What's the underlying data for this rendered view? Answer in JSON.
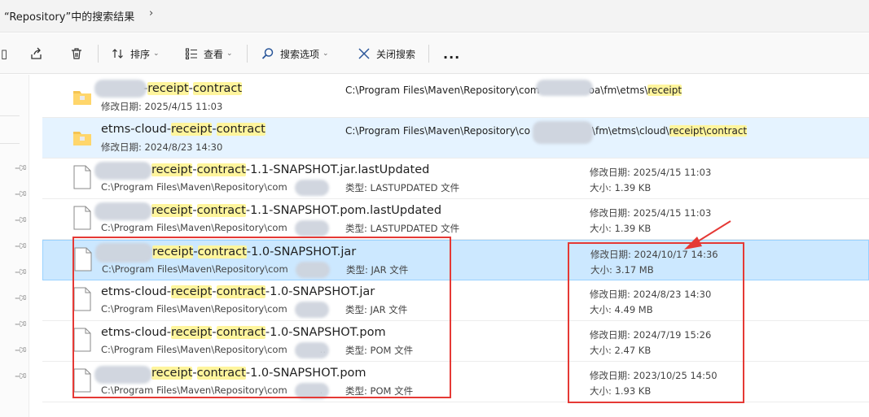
{
  "breadcrumb": {
    "title": "“Repository”中的搜索结果"
  },
  "toolbar": {
    "sort_label": "排序",
    "view_label": "查看",
    "search_options_label": "搜索选项",
    "close_search_label": "关闭搜索",
    "more_label": "..."
  },
  "labels": {
    "modified": "修改日期:",
    "size": "大小:",
    "type": "类型:"
  },
  "folders": [
    {
      "name_pre": "-",
      "name_hl1": "receipt",
      "name_mid": "-",
      "name_hl2": "contract",
      "name_post": "",
      "date": "2025/4/15 11:03",
      "path_pre": "C:\\Program Files\\Maven\\Repository\\com",
      "path_post": "oa\\fm\\etms\\",
      "path_hl": "receipt",
      "path_tail": ""
    },
    {
      "name_pre": "etms-cloud-",
      "name_hl1": "receipt",
      "name_mid": "-",
      "name_hl2": "contract",
      "name_post": "",
      "date": "2024/8/23 14:30",
      "path_pre": "C:\\Program Files\\Maven\\Repository\\co",
      "path_post": "\\fm\\etms\\cloud\\",
      "path_hl": "receipt\\contract",
      "path_tail": ""
    }
  ],
  "files": [
    {
      "name_pre": "",
      "name_hl1": "receipt",
      "name_mid": "-",
      "name_hl2": "contract",
      "name_post": "-1.1-SNAPSHOT.jar.lastUpdated",
      "path": "C:\\Program Files\\Maven\\Repository\\com",
      "type": "LASTUPDATED 文件",
      "date": "2025/4/15 11:03",
      "size": "1.39 KB"
    },
    {
      "name_pre": "",
      "name_hl1": "receipt",
      "name_mid": "-",
      "name_hl2": "contract",
      "name_post": "-1.1-SNAPSHOT.pom.lastUpdated",
      "path": "C:\\Program Files\\Maven\\Repository\\com",
      "type": "LASTUPDATED 文件",
      "date": "2025/4/15 11:03",
      "size": "1.39 KB"
    },
    {
      "name_pre": "",
      "name_hl1": "receipt",
      "name_mid": "-",
      "name_hl2": "contract",
      "name_post": "-1.0-SNAPSHOT.jar",
      "path": "C:\\Program Files\\Maven\\Repository\\com",
      "type": "JAR 文件",
      "date": "2024/10/17 14:36",
      "size": "3.17 MB"
    },
    {
      "name_pre": "etms-cloud-",
      "name_hl1": "receipt",
      "name_mid": "-",
      "name_hl2": "contract",
      "name_post": "-1.0-SNAPSHOT.jar",
      "path": "C:\\Program Files\\Maven\\Repository\\com",
      "type": "JAR 文件",
      "date": "2024/8/23 14:30",
      "size": "4.49 MB"
    },
    {
      "name_pre": "etms-cloud-",
      "name_hl1": "receipt",
      "name_mid": "-",
      "name_hl2": "contract",
      "name_post": "-1.0-SNAPSHOT.pom",
      "path": "C:\\Program Files\\Maven\\Repository\\com",
      "path_ellipsis": "..",
      "type": "POM 文件",
      "date": "2024/7/19 15:26",
      "size": "2.47 KB"
    },
    {
      "name_pre": "",
      "name_hl1": "receipt",
      "name_mid": "-",
      "name_hl2": "contract",
      "name_post": "-1.0-SNAPSHOT.pom",
      "path": "C:\\Program Files\\Maven\\Repository\\com",
      "path_ellipsis": ".",
      "type": "POM 文件",
      "date": "2023/10/25 14:50",
      "size": "1.93 KB"
    }
  ],
  "colors": {
    "highlight": "#fff59d",
    "selection": "#cce8ff",
    "annotation": "#e53935",
    "folder": "#f5c451"
  }
}
